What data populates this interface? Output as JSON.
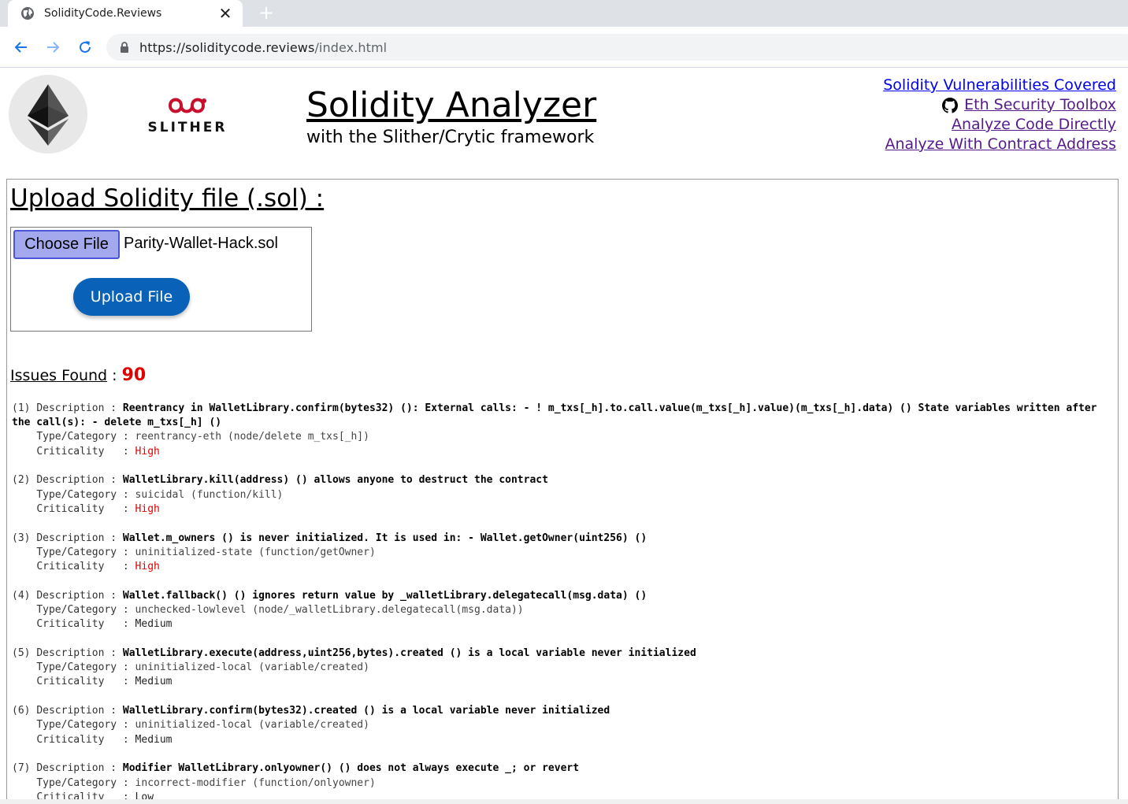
{
  "browser": {
    "tab_title": "SolidityCode.Reviews",
    "url_host": "https://soliditycode.reviews",
    "url_path": "/index.html"
  },
  "header": {
    "logo_word": "SLITHER",
    "title": "Solidity Analyzer",
    "subtitle": "with the Slither/Crytic framework",
    "links": {
      "vulns": "Solidity Vulnerabilities Covered",
      "toolbox": "Eth Security Toolbox",
      "analyze_code": "Analyze Code Directly",
      "analyze_address": "Analyze With Contract Address"
    }
  },
  "upload": {
    "heading": "Upload Solidity file (.sol) :",
    "choose_label": "Choose File",
    "file_name": "Parity-Wallet-Hack.sol",
    "upload_label": "Upload File"
  },
  "issues_summary": {
    "label": "Issues Found",
    "separator": " : ",
    "count": "90"
  },
  "labels": {
    "description": "Description    : ",
    "type": "Type/Category : ",
    "criticality": "Criticality   : "
  },
  "issues": [
    {
      "num": "(1) ",
      "description": "Reentrancy in WalletLibrary.confirm(bytes32) (): External calls: - ! m_txs[_h].to.call.value(m_txs[_h].value)(m_txs[_h].data) () State variables written after the call(s): - delete m_txs[_h] ()",
      "type": "reentrancy-eth (node/delete m_txs[_h])",
      "criticality": "High"
    },
    {
      "num": "(2) ",
      "description": "WalletLibrary.kill(address) () allows anyone to destruct the contract",
      "type": "suicidal (function/kill)",
      "criticality": "High"
    },
    {
      "num": "(3) ",
      "description": "Wallet.m_owners () is never initialized. It is used in: - Wallet.getOwner(uint256) ()",
      "type": "uninitialized-state (function/getOwner)",
      "criticality": "High"
    },
    {
      "num": "(4) ",
      "description": "Wallet.fallback() () ignores return value by _walletLibrary.delegatecall(msg.data) ()",
      "type": "unchecked-lowlevel (node/_walletLibrary.delegatecall(msg.data))",
      "criticality": "Medium"
    },
    {
      "num": "(5) ",
      "description": "WalletLibrary.execute(address,uint256,bytes).created () is a local variable never initialized",
      "type": "uninitialized-local (variable/created)",
      "criticality": "Medium"
    },
    {
      "num": "(6) ",
      "description": "WalletLibrary.confirm(bytes32).created () is a local variable never initialized",
      "type": "uninitialized-local (variable/created)",
      "criticality": "Medium"
    },
    {
      "num": "(7) ",
      "description": "Modifier WalletLibrary.onlyowner() () does not always execute _; or revert",
      "type": "incorrect-modifier (function/onlyowner)",
      "criticality": "Low"
    }
  ]
}
